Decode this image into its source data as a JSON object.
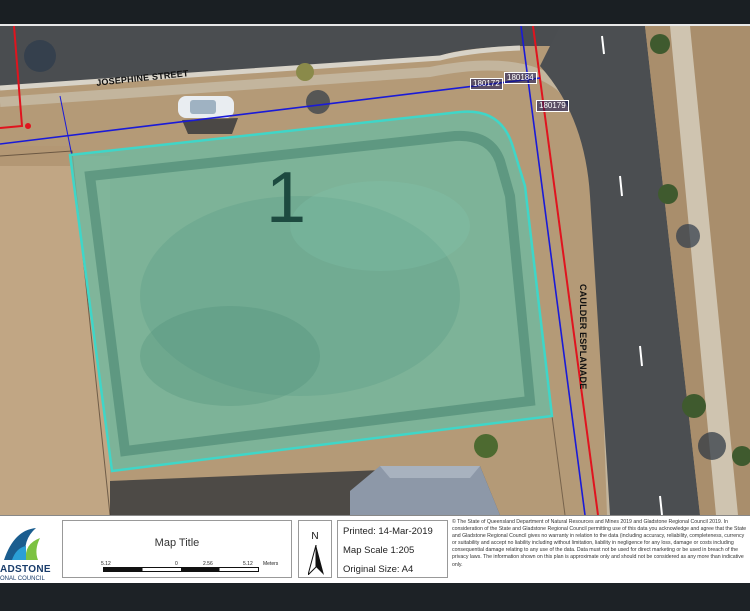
{
  "map": {
    "streets": {
      "josephine": "JOSEPHINE STREET",
      "caulder": "CAULDER ESPLANADE"
    },
    "lot_number": "1",
    "parcel_tags": [
      "180172",
      "180184",
      "180179"
    ]
  },
  "footer": {
    "logo": {
      "line1": "ADSTONE",
      "line2": "ONAL COUNCIL"
    },
    "map_title": "Map Title",
    "scale_ticks": [
      "5.12",
      "0",
      "2.56",
      "5.12",
      "Meters"
    ],
    "north_label": "N",
    "printed": "Printed: 14-Mar-2019",
    "map_scale": "Map Scale 1:205",
    "original_size": "Original Size: A4",
    "disclaimer": "© The State of Queensland Department of Natural Resources and Mines 2019 and Gladstone Regional Council 2019. In consideration of the State and Gladstone Regional Council permitting use of this data you acknowledge and agree that the State and Gladstone Regional Council gives no warranty in relation to the data (including accuracy, reliability, completeness, currency or suitability and accept no liability including without limitation, liability in negligence for any loss, damage or costs including consequential damage relating to any use of the data. Data must not be used for direct marketing or be used in breach of the privacy laws. The information shown on this plan is approximate only and should not be considered as any more than indicative only."
  },
  "colors": {
    "lot_outline": "#3fd6c8",
    "lot_fill": "#6fb9a0",
    "cadastre_blue": "#1a1ad8",
    "road_boundary_red": "#e0141e",
    "road_asphalt": "#4a4d50"
  }
}
